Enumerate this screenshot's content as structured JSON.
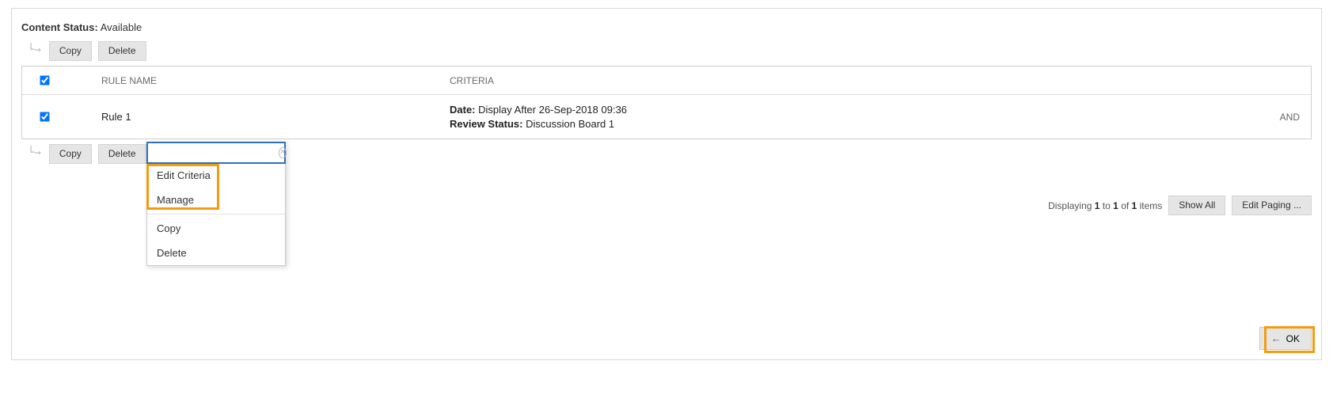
{
  "status": {
    "label": "Content Status:",
    "value": "Available"
  },
  "toolbar": {
    "copy": "Copy",
    "delete": "Delete"
  },
  "columns": {
    "rule_name": "RULE NAME",
    "criteria": "CRITERIA"
  },
  "rows": [
    {
      "checked": true,
      "name": "Rule 1",
      "criteria": {
        "date_label": "Date:",
        "date_value": "Display After 26-Sep-2018 09:36",
        "review_label": "Review Status:",
        "review_value": "Discussion Board 1"
      },
      "operator": "AND"
    }
  ],
  "context_menu": {
    "search_placeholder": "",
    "items": [
      "Edit Criteria",
      "Manage",
      "Copy",
      "Delete"
    ]
  },
  "pager": {
    "prefix": "Displaying",
    "from": "1",
    "to_word": "to",
    "to": "1",
    "of_word": "of",
    "total": "1",
    "suffix": "items",
    "show_all": "Show All",
    "edit_paging": "Edit Paging ..."
  },
  "footer": {
    "ok": "OK"
  }
}
